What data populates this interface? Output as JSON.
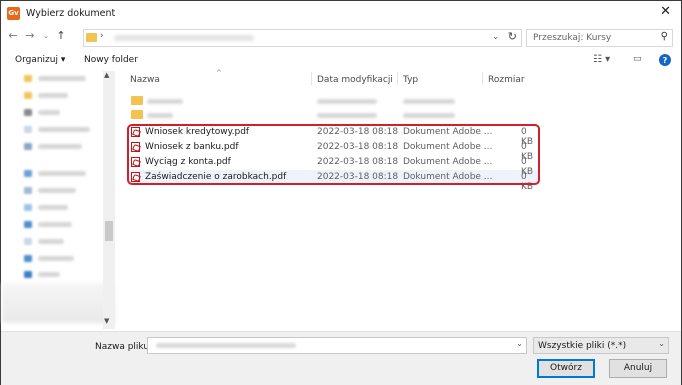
{
  "window": {
    "title": "Wybierz dokument",
    "app_icon_text": "Gv"
  },
  "nav": {
    "search_placeholder": "Przeszukaj: Kursy"
  },
  "toolbar": {
    "organize": "Organizuj ▾",
    "new_folder": "Nowy folder"
  },
  "columns": {
    "name": "Nazwa",
    "date": "Data modyfikacji",
    "type": "Typ",
    "size": "Rozmiar"
  },
  "files": [
    {
      "name": "Wniosek kredytowy.pdf",
      "date": "2022-03-18 08:18",
      "type": "Dokument Adobe ...",
      "size": "0 KB"
    },
    {
      "name": "Wniosek z banku.pdf",
      "date": "2022-03-18 08:18",
      "type": "Dokument Adobe ...",
      "size": "0 KB"
    },
    {
      "name": "Wyciąg z konta.pdf",
      "date": "2022-03-18 08:18",
      "type": "Dokument Adobe ...",
      "size": "0 KB"
    },
    {
      "name": "Zaświadczenie o zarobkach.pdf",
      "date": "2022-03-18 08:18",
      "type": "Dokument Adobe ...",
      "size": "0 KB"
    }
  ],
  "footer": {
    "filename_label": "Nazwa pliku:",
    "filter": "Wszystkie pliki (*.*)",
    "open_button": "Otwórz",
    "cancel_button": "Anuluj"
  },
  "colors": {
    "highlight": "#d0202a",
    "accent": "#0078d7",
    "folder": "#f3c352"
  }
}
